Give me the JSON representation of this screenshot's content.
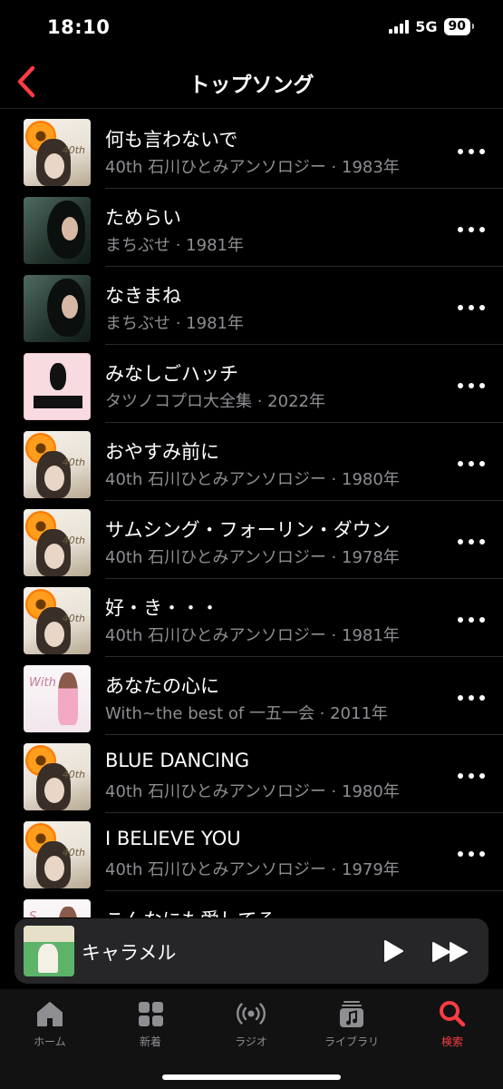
{
  "status": {
    "time": "18:10",
    "network": "5G",
    "battery": "90"
  },
  "nav": {
    "title": "トップソング",
    "back_icon": "chevron-left-icon",
    "accent_color": "#fc3c44"
  },
  "songs": [
    {
      "title": "何も言わないで",
      "subtitle": "40th 石川ひとみアンソロジー · 1983年",
      "art": "orange"
    },
    {
      "title": "ためらい",
      "subtitle": "まちぶせ · 1981年",
      "art": "green"
    },
    {
      "title": "なきまね",
      "subtitle": "まちぶせ · 1981年",
      "art": "green"
    },
    {
      "title": "みなしごハッチ",
      "subtitle": "タツノコプロ大全集 · 2022年",
      "art": "pink"
    },
    {
      "title": "おやすみ前に",
      "subtitle": "40th 石川ひとみアンソロジー · 1980年",
      "art": "orange"
    },
    {
      "title": "サムシング・フォーリン・ダウン",
      "subtitle": "40th 石川ひとみアンソロジー · 1978年",
      "art": "orange"
    },
    {
      "title": "好・き・・・",
      "subtitle": "40th 石川ひとみアンソロジー · 1981年",
      "art": "orange"
    },
    {
      "title": "あなたの心に",
      "subtitle": "With~the best of 一五一会 · 2011年",
      "art": "white"
    },
    {
      "title": "BLUE DANCING",
      "subtitle": "40th 石川ひとみアンソロジー · 1980年",
      "art": "orange"
    },
    {
      "title": "I BELIEVE YOU",
      "subtitle": "40th 石川ひとみアンソロジー · 1979年",
      "art": "orange"
    },
    {
      "title": "こんなにも愛してる",
      "subtitle": "",
      "art": "white"
    }
  ],
  "mini_player": {
    "title": "キャラメル",
    "play_icon": "play-icon",
    "forward_icon": "fast-forward-icon"
  },
  "tabs": [
    {
      "label": "ホーム",
      "icon": "home-icon",
      "active": false
    },
    {
      "label": "新着",
      "icon": "grid-icon",
      "active": false
    },
    {
      "label": "ラジオ",
      "icon": "radio-icon",
      "active": false
    },
    {
      "label": "ライブラリ",
      "icon": "library-icon",
      "active": false
    },
    {
      "label": "検索",
      "icon": "search-icon",
      "active": true
    }
  ]
}
